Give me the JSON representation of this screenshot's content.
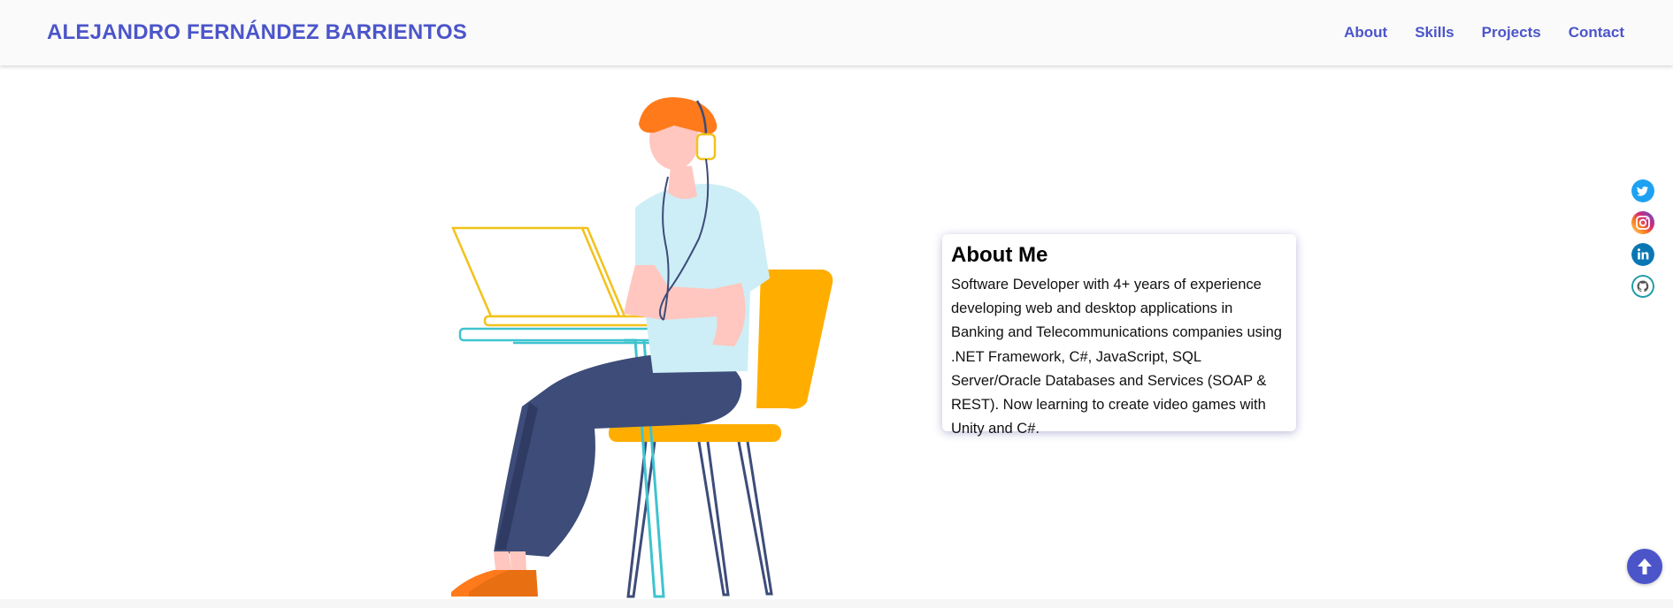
{
  "header": {
    "brand": "ALEJANDRO FERNÁNDEZ BARRIENTOS",
    "nav": [
      {
        "label": "About"
      },
      {
        "label": "Skills"
      },
      {
        "label": "Projects"
      },
      {
        "label": "Contact"
      }
    ]
  },
  "about": {
    "title": "About Me",
    "text": "Software Developer with 4+ years of experience developing web and desktop applications in Banking and Telecommunications companies using .NET Framework, C#, JavaScript, SQL Server/Oracle Databases and Services (SOAP & REST). Now learning to create video games with Unity and C#."
  },
  "social": [
    {
      "icon": "twitter-icon",
      "color": "#1da1f2"
    },
    {
      "icon": "instagram-icon",
      "color": "#c13584"
    },
    {
      "icon": "linkedin-icon",
      "color": "#0a77b5"
    },
    {
      "icon": "github-icon",
      "color": "#1f9aa8"
    }
  ],
  "colors": {
    "accent": "#4b55c9",
    "chair": "#ffae00",
    "shirt": "#cdeef6",
    "pants": "#3d4c79",
    "hair": "#ff7a1a",
    "laptop": "#f2c21b",
    "desk": "#3fc3cf"
  },
  "scroll_top_icon": "arrow-up-icon"
}
